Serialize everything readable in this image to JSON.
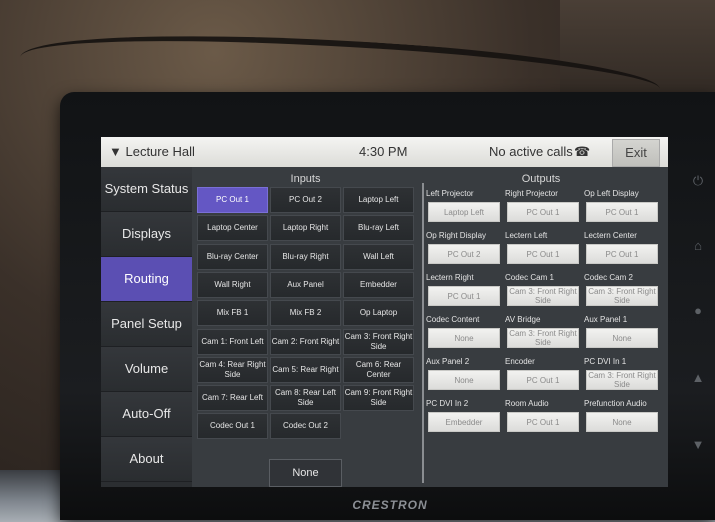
{
  "header": {
    "room": "Lecture Hall",
    "time": "4:30 PM",
    "calls": "No active calls",
    "exit": "Exit"
  },
  "nav": [
    {
      "label": "System Status"
    },
    {
      "label": "Displays"
    },
    {
      "label": "Routing",
      "active": true
    },
    {
      "label": "Panel Setup"
    },
    {
      "label": "Volume"
    },
    {
      "label": "Auto-Off"
    },
    {
      "label": "About"
    }
  ],
  "inputs_title": "Inputs",
  "outputs_title": "Outputs",
  "inputs": [
    [
      "PC Out 1",
      "PC Out 2",
      "Laptop Left"
    ],
    [
      "Laptop Center",
      "Laptop Right",
      "Blu-ray Left"
    ],
    [
      "Blu-ray Center",
      "Blu-ray Right",
      "Wall Left"
    ],
    [
      "Wall Right",
      "Aux Panel",
      "Embedder"
    ],
    [
      "Mix FB 1",
      "Mix FB 2",
      "Op Laptop"
    ],
    [
      "Cam 1: Front Left",
      "Cam 2: Front Right",
      "Cam 3: Front Right Side"
    ],
    [
      "Cam 4: Rear Right Side",
      "Cam 5: Rear Right",
      "Cam 6: Rear Center"
    ],
    [
      "Cam 7: Rear Left",
      "Cam 8: Rear Left Side",
      "Cam 9: Front Right Side"
    ],
    [
      "Codec Out 1",
      "Codec Out 2",
      ""
    ]
  ],
  "selected_input": "PC Out 1",
  "none_button": "None",
  "outputs": [
    [
      {
        "label": "Left Projector",
        "value": "Laptop Left"
      },
      {
        "label": "Right Projector",
        "value": "PC Out 1"
      },
      {
        "label": "Op Left Display",
        "value": "PC Out 1"
      }
    ],
    [
      {
        "label": "Op Right Display",
        "value": "PC Out 2"
      },
      {
        "label": "Lectern Left",
        "value": "PC Out 1"
      },
      {
        "label": "Lectern Center",
        "value": "PC Out 1"
      }
    ],
    [
      {
        "label": "Lectern Right",
        "value": "PC Out 1"
      },
      {
        "label": "Codec Cam 1",
        "value": "Cam 3: Front Right Side"
      },
      {
        "label": "Codec Cam 2",
        "value": "Cam 3: Front Right Side"
      }
    ],
    [
      {
        "label": "Codec Content",
        "value": "None"
      },
      {
        "label": "AV Bridge",
        "value": "Cam 3: Front Right Side"
      },
      {
        "label": "Aux Panel 1",
        "value": "None"
      }
    ],
    [
      {
        "label": "Aux Panel 2",
        "value": "None"
      },
      {
        "label": "Encoder",
        "value": "PC Out 1"
      },
      {
        "label": "PC DVI In 1",
        "value": "Cam 3: Front Right Side"
      }
    ],
    [
      {
        "label": "PC DVI In 2",
        "value": "Embedder"
      },
      {
        "label": "Room Audio",
        "value": "PC Out 1"
      },
      {
        "label": "Prefunction Audio",
        "value": "None"
      }
    ]
  ],
  "brand": "CRESTRON",
  "side_icons": [
    "power-icon",
    "home-icon",
    "lightbulb-icon",
    "up-arrow-icon",
    "down-arrow-icon"
  ]
}
